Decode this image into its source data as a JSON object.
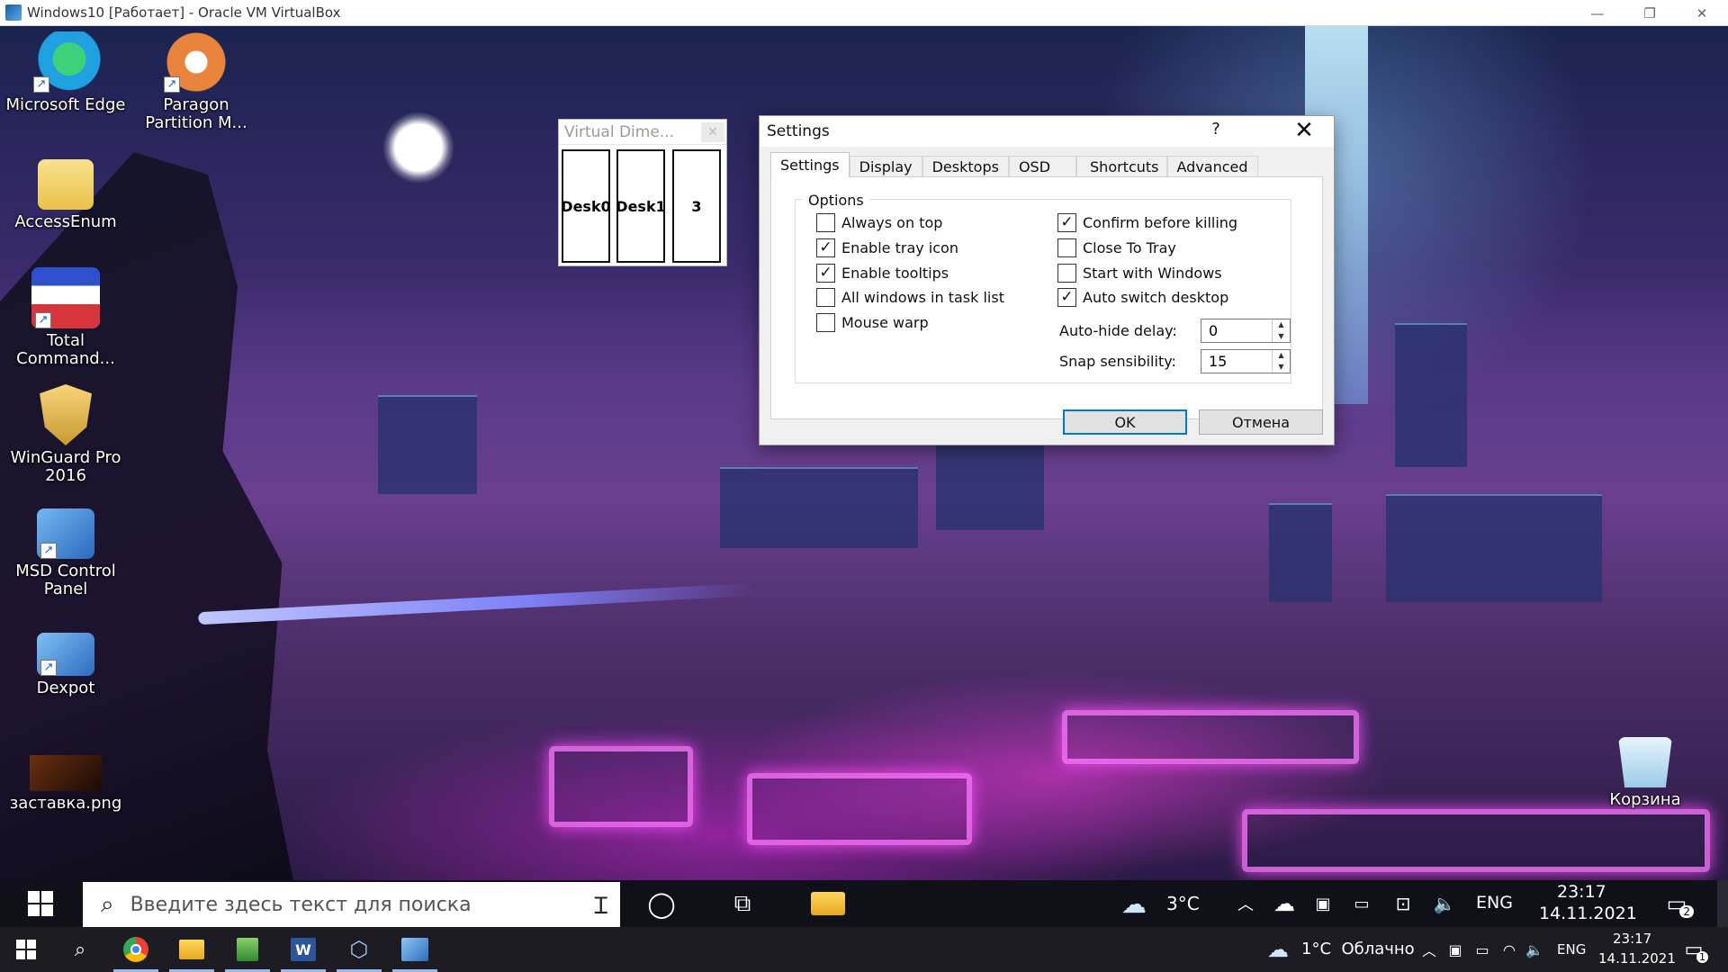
{
  "host_window": {
    "title": "Windows10 [Работает] - Oracle VM VirtualBox",
    "controls": {
      "minimize": "—",
      "restore": "❐",
      "close": "✕"
    }
  },
  "desktop_icons": [
    {
      "name": "Microsoft Edge",
      "icon": "edge-icon",
      "color": "#1fa0e0"
    },
    {
      "name": "Paragon Partition M...",
      "icon": "paragon-icon",
      "color": "#e8843c"
    },
    {
      "name": "AccessEnum",
      "icon": "folder-icon",
      "color": "#f4d76a"
    },
    {
      "name": "Total Command...",
      "icon": "total-commander-icon",
      "color": "#d8343c"
    },
    {
      "name": "WinGuard Pro 2016",
      "icon": "shield-icon",
      "color": "#f0c060"
    },
    {
      "name": "MSD Control Panel",
      "icon": "control-panel-icon",
      "color": "#4a8ad8"
    },
    {
      "name": "Dexpot",
      "icon": "dexpot-icon",
      "color": "#3b7fd0"
    },
    {
      "name": "заставка.png",
      "icon": "image-file-icon",
      "color": "#3a2010"
    },
    {
      "name": "Корзина",
      "icon": "recycle-bin-icon",
      "color": "#b9dff5"
    }
  ],
  "vd_window": {
    "title": "Virtual Dime...",
    "close": "✕",
    "desktops": [
      "Desk0",
      "Desk1",
      "3"
    ]
  },
  "settings": {
    "title": "Settings",
    "help": "?",
    "close": "✕",
    "tabs": [
      "Settings",
      "Display",
      "Desktops",
      "OSD",
      "Shortcuts",
      "Advanced"
    ],
    "active_tab": "Settings",
    "group_label": "Options",
    "options_left": [
      {
        "label": "Always on top",
        "checked": false
      },
      {
        "label": "Enable tray icon",
        "checked": true
      },
      {
        "label": "Enable tooltips",
        "checked": true
      },
      {
        "label": "All windows in task list",
        "checked": false
      },
      {
        "label": "Mouse warp",
        "checked": false
      }
    ],
    "options_right": [
      {
        "label": "Confirm before killing",
        "checked": true
      },
      {
        "label": "Close To Tray",
        "checked": false
      },
      {
        "label": "Start with Windows",
        "checked": false
      },
      {
        "label": "Auto switch desktop",
        "checked": true
      }
    ],
    "auto_hide_label": "Auto-hide delay:",
    "auto_hide_value": "0",
    "snap_label": "Snap sensibility:",
    "snap_value": "15",
    "ok_label": "OK",
    "cancel_label": "Отмена"
  },
  "guest_taskbar": {
    "search_placeholder": "Введите здесь текст для поиска",
    "weather_temp": "3°C",
    "lang": "ENG",
    "time": "23:17",
    "date": "14.11.2021",
    "notification_count": "2"
  },
  "host_taskbar": {
    "apps": [
      "start",
      "search",
      "chrome",
      "explorer",
      "notepad",
      "word",
      "virtualbox",
      "virtual-dimension"
    ],
    "weather": "1°C  Облачно",
    "lang": "ENG",
    "time": "23:17",
    "date": "14.11.2021",
    "notification_count": "1"
  }
}
